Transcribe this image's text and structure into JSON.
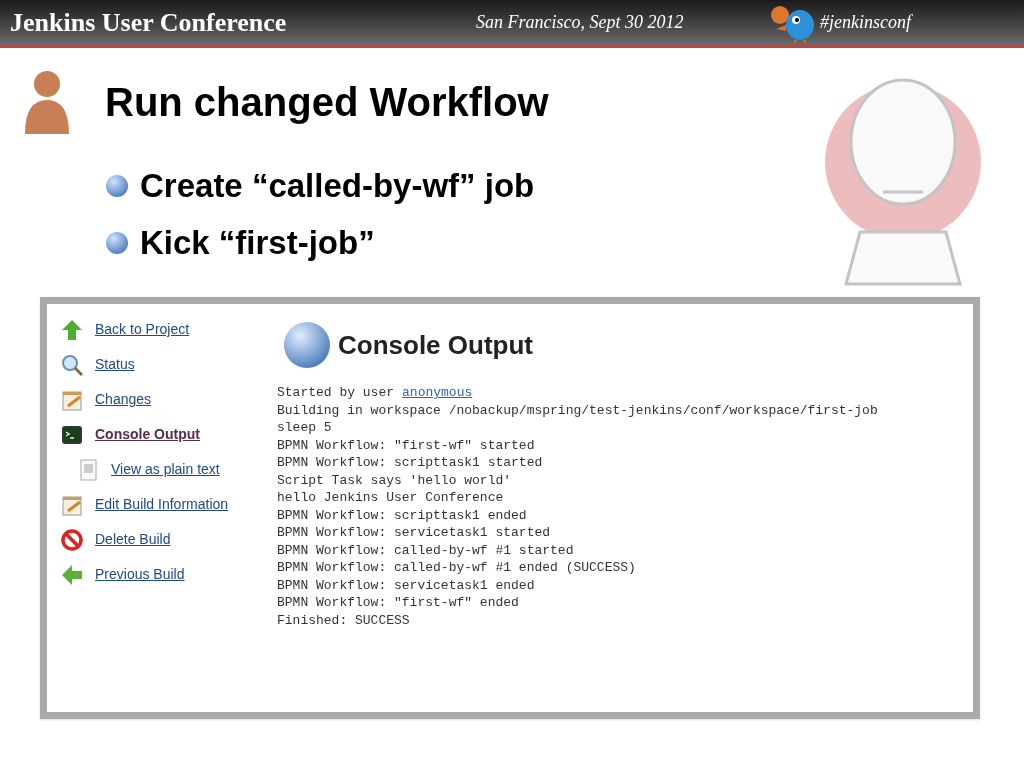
{
  "header": {
    "title": "Jenkins User Conference",
    "place_date": "San Francisco, Sept 30 2012",
    "hashtag": "#jenkinsconf"
  },
  "slide": {
    "title": "Run changed Workflow",
    "bullets": [
      "Create “called-by-wf” job",
      "Kick “first-job”"
    ]
  },
  "screenshot": {
    "sidebar": [
      {
        "kind": "up",
        "label": "Back to Project",
        "selected": false
      },
      {
        "kind": "search",
        "label": "Status",
        "selected": false
      },
      {
        "kind": "notepad",
        "label": "Changes",
        "selected": false
      },
      {
        "kind": "terminal",
        "label": "Console Output",
        "selected": true,
        "children": [
          {
            "kind": "document",
            "label": "View as plain text",
            "selected": false
          }
        ]
      },
      {
        "kind": "notepad",
        "label": "Edit Build Information",
        "selected": false
      },
      {
        "kind": "delete",
        "label": "Delete Build",
        "selected": false
      },
      {
        "kind": "back",
        "label": "Previous Build",
        "selected": false
      }
    ],
    "heading": "Console Output",
    "started_by": {
      "prefix": "Started by user",
      "user": "anonymous"
    },
    "lines": [
      "Building in workspace /nobackup/mspring/test-jenkins/conf/workspace/first-job",
      "sleep 5",
      "BPMN Workflow: \"first-wf\" started",
      "BPMN Workflow: scripttask1 started",
      "Script Task says 'hello world'",
      "hello Jenkins User Conference",
      "BPMN Workflow: scripttask1 ended",
      "BPMN Workflow: servicetask1 started",
      "BPMN Workflow: called-by-wf #1 started",
      "BPMN Workflow: called-by-wf #1 ended (SUCCESS)",
      "BPMN Workflow: servicetask1 ended",
      "BPMN Workflow: \"first-wf\" ended",
      "Finished: SUCCESS"
    ]
  }
}
